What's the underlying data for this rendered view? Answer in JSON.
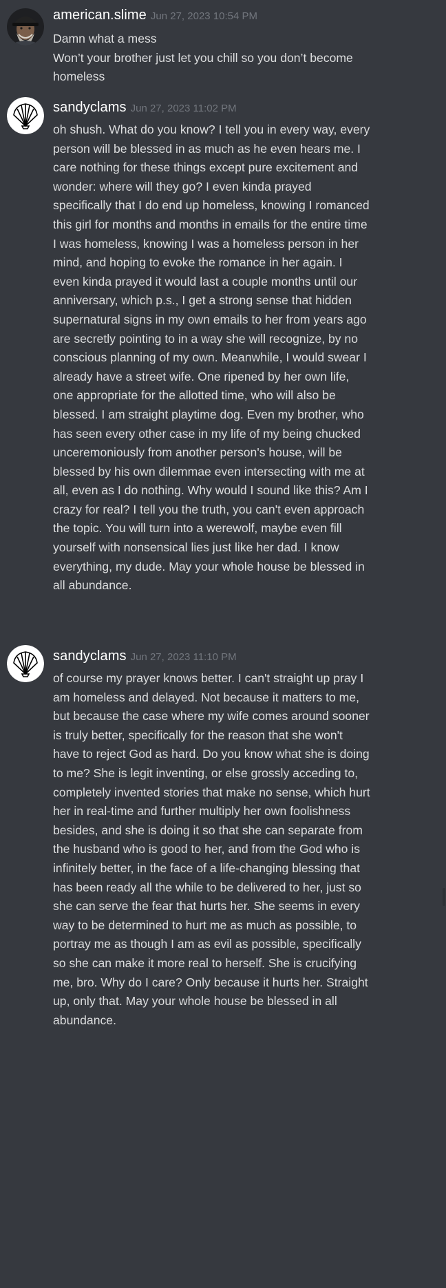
{
  "messages": [
    {
      "username": "american.slime",
      "timestamp": "Jun 27, 2023 10:54 PM",
      "avatar": "man-with-cap-photo",
      "text": "Damn what a mess\nWon’t your brother just let you chill so you don’t become homeless"
    },
    {
      "username": "sandyclams",
      "timestamp": "Jun 27, 2023 11:02 PM",
      "avatar": "seashell-icon",
      "text": "oh shush. What do you know? I tell you in every way, every person will be blessed in as much as he even hears me. I care nothing for these things except pure excitement and wonder: where will they go? I even kinda prayed specifically that I do end up homeless, knowing I romanced this girl for months and months in emails for the entire time I was homeless, knowing I was a homeless person in her mind, and hoping to evoke the romance in her again. I even kinda prayed it would last a couple months until our anniversary, which p.s., I get a strong sense that hidden supernatural signs in my own emails to her from years ago are secretly pointing to in a way she will recognize, by no conscious planning of my own. Meanwhile, I would swear I already have a street wife. One ripened by her own life, one appropriate for the allotted time, who will also be blessed. I am straight playtime dog. Even my brother, who has seen every other case in my life of my being chucked unceremoniously from another person's house, will be blessed by his own dilemmae even intersecting with me at all, even as I do nothing. Why would I sound like this? Am I crazy for real? I tell you the truth, you can't even approach the topic. You will turn into a werewolf, maybe even fill yourself with nonsensical lies just like her dad. I know everything, my dude. May your whole house be blessed in all abundance."
    },
    {
      "username": "sandyclams",
      "timestamp": "Jun 27, 2023 11:10 PM",
      "avatar": "seashell-icon",
      "text": "of course my prayer knows better. I can't straight up pray I am homeless and delayed. Not because it matters to me, but because the case where my wife comes around sooner is truly better, specifically for the reason that she won't have to reject God as hard. Do you know what she is doing to me? She is legit inventing, or else grossly acceding to, completely invented stories that make no sense, which hurt her in real-time and further multiply her own foolishness besides, and she is doing it so that she can separate from the husband who is good to her, and from the God who is infinitely better, in the face of a life-changing blessing that has been ready all the while to be delivered to her, just so she can serve the fear that hurts her. She seems in every way to be determined to hurt me as much as possible, to portray me as though I am as evil as possible, specifically so she can make it more real to herself. She is crucifying me, bro. Why do I care? Only because it hurts her. Straight up, only that. May your whole house be blessed in all abundance."
    }
  ],
  "colors": {
    "background": "#36393f",
    "username": "#ffffff",
    "timestamp": "#72767d",
    "text": "#dcddde"
  }
}
